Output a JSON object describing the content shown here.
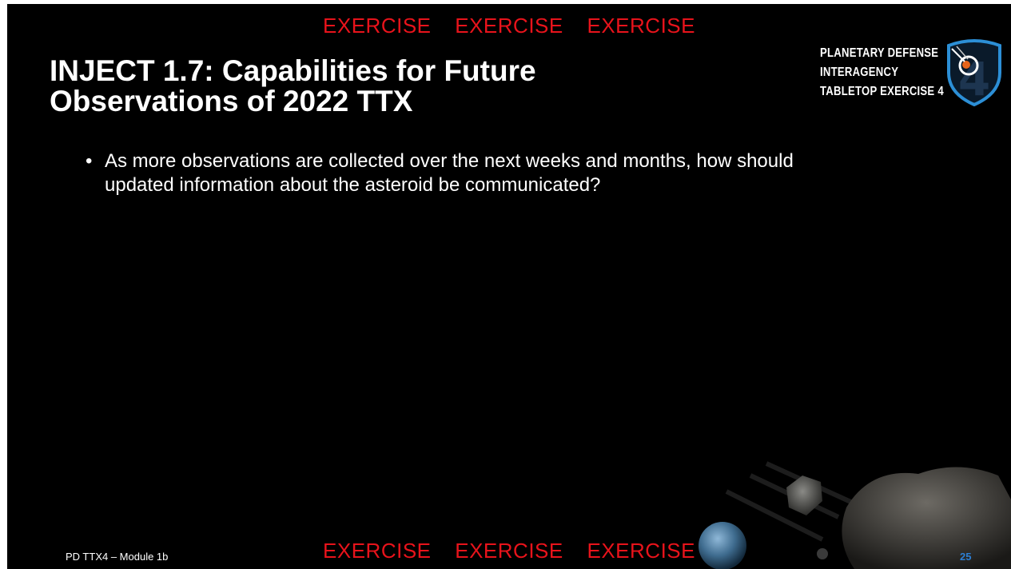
{
  "banner": {
    "top": [
      "EXERCISE",
      "EXERCISE",
      "EXERCISE"
    ],
    "bottom": [
      "EXERCISE",
      "EXERCISE",
      "EXERCISE"
    ],
    "color": "#e8131b"
  },
  "slide": {
    "title_line1": "INJECT 1.7: Capabilities for Future",
    "title_line2": "Observations of 2022 TTX",
    "bullets": [
      {
        "line1": "As more observations are collected over the next weeks and months, how should",
        "line2": "updated information about the asteroid be communicated?"
      }
    ]
  },
  "logo": {
    "line1": "PLANETARY DEFENSE",
    "line2": "INTERAGENCY",
    "line3": "TABLETOP EXERCISE 4",
    "emblem_icon": "planetary-defense-shield-icon",
    "emblem_numeral": "4"
  },
  "footer": {
    "label": "PD TTX4 – Module 1b",
    "page_number": "25",
    "page_number_color": "#2d7fd3"
  },
  "decor": {
    "icons": [
      "earth-icon",
      "asteroid-icon",
      "large-asteroid-icon"
    ]
  }
}
